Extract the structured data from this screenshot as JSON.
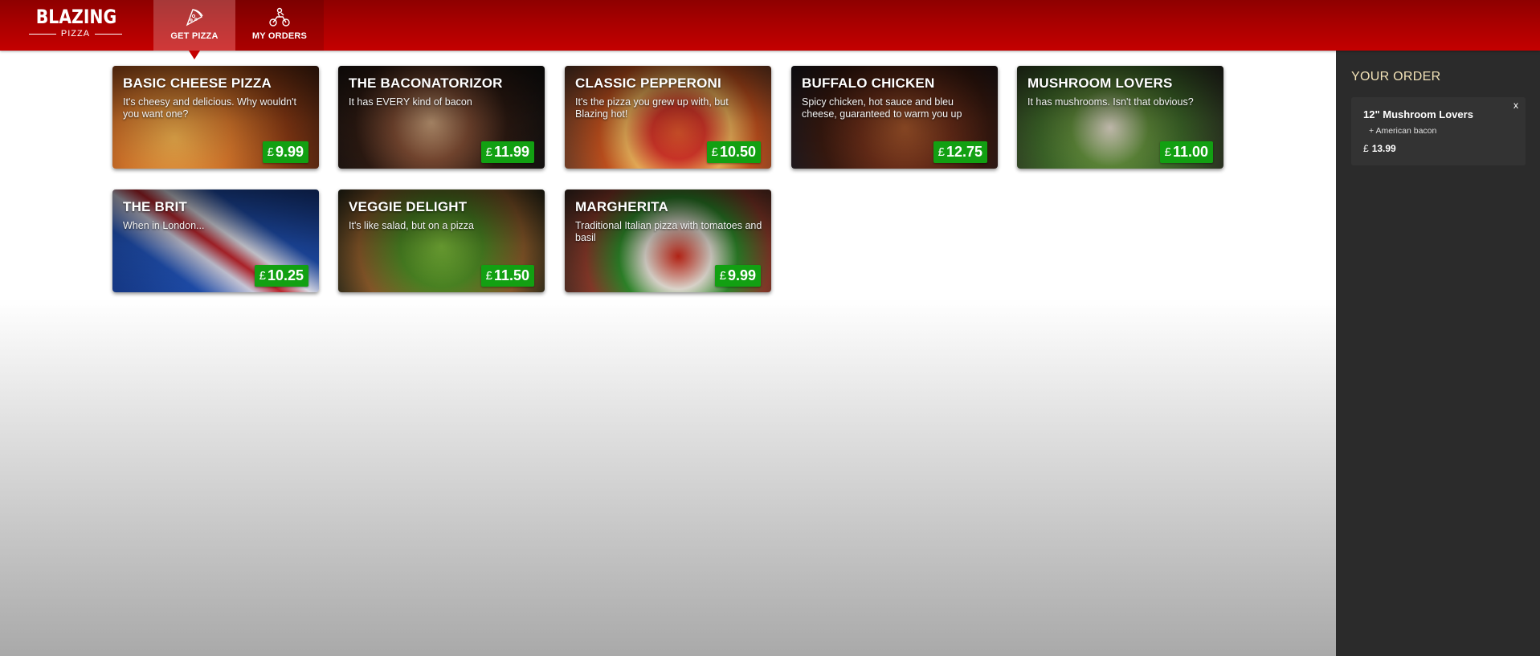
{
  "header": {
    "logo_main": "BLAZING",
    "logo_sub": "PIZZA",
    "tabs": [
      {
        "label": "GET PIZZA",
        "icon": "pizza-slice-icon",
        "active": true
      },
      {
        "label": "MY ORDERS",
        "icon": "delivery-scooter-icon",
        "active": false
      }
    ]
  },
  "currency_symbol": "£",
  "specials": [
    {
      "name": "BASIC CHEESE PIZZA",
      "description": "It's cheesy and delicious. Why wouldn't you want one?",
      "price": "9.99"
    },
    {
      "name": "THE BACONATORIZOR",
      "description": "It has EVERY kind of bacon",
      "price": "11.99"
    },
    {
      "name": "CLASSIC PEPPERONI",
      "description": "It's the pizza you grew up with, but Blazing hot!",
      "price": "10.50"
    },
    {
      "name": "BUFFALO CHICKEN",
      "description": "Spicy chicken, hot sauce and bleu cheese, guaranteed to warm you up",
      "price": "12.75"
    },
    {
      "name": "MUSHROOM LOVERS",
      "description": "It has mushrooms. Isn't that obvious?",
      "price": "11.00"
    },
    {
      "name": "THE BRIT",
      "description": "When in London...",
      "price": "10.25"
    },
    {
      "name": "VEGGIE DELIGHT",
      "description": "It's like salad, but on a pizza",
      "price": "11.50"
    },
    {
      "name": "MARGHERITA",
      "description": "Traditional Italian pizza with tomatoes and basil",
      "price": "9.99"
    }
  ],
  "order": {
    "title": "YOUR ORDER",
    "items": [
      {
        "name": "12\" Mushroom Lovers",
        "topping": "+ American bacon",
        "price": "13.99",
        "remove_label": "x"
      }
    ]
  },
  "colors": {
    "header_red": "#c40000",
    "price_green": "#12a012",
    "sidebar_bg": "#2b2b2b",
    "sidebar_title": "#f3e3b8"
  }
}
